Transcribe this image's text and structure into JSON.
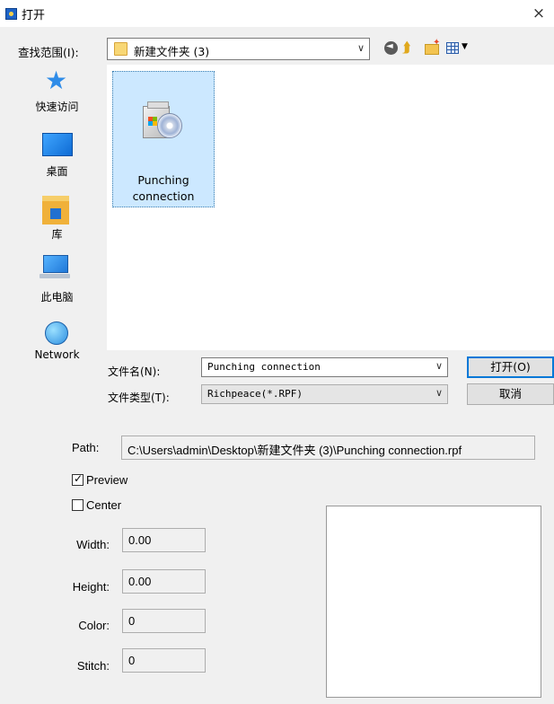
{
  "window": {
    "title": "打开",
    "close_glyph": "×"
  },
  "lookin": {
    "label": "查找范围(I):",
    "value": "新建文件夹 (3)",
    "toolbar_icons": [
      "back-icon",
      "up-folder-icon",
      "new-folder-icon",
      "view-menu-icon"
    ]
  },
  "places": [
    {
      "label": "快速访问",
      "icon": "quick-access-star-icon"
    },
    {
      "label": "桌面",
      "icon": "desktop-icon"
    },
    {
      "label": "库",
      "icon": "library-icon"
    },
    {
      "label": "此电脑",
      "icon": "this-pc-icon"
    },
    {
      "label": "Network",
      "icon": "network-icon"
    }
  ],
  "files": [
    {
      "name_line1": "Punching",
      "name_line2": "connection",
      "icon": "setup-package-icon",
      "selected": true
    }
  ],
  "filename": {
    "label": "文件名(N):",
    "value": "Punching connection"
  },
  "filetype": {
    "label": "文件类型(T):",
    "value": "Richpeace(*.RPF)"
  },
  "buttons": {
    "open": "打开(O)",
    "cancel": "取消"
  },
  "path": {
    "label": "Path:",
    "value": "C:\\Users\\admin\\Desktop\\新建文件夹 (3)\\Punching connection.rpf"
  },
  "options": {
    "preview": {
      "label": "Preview",
      "checked": true
    },
    "center": {
      "label": "Center",
      "checked": false
    }
  },
  "properties": [
    {
      "label": "Width:",
      "value": "0.00"
    },
    {
      "label": "Height:",
      "value": "0.00"
    },
    {
      "label": "Color:",
      "value": "0"
    },
    {
      "label": "Stitch:",
      "value": "0"
    }
  ],
  "colors": {
    "accent": "#0078d7",
    "selection": "#cce8ff",
    "window_bg": "#f0f0f0"
  }
}
